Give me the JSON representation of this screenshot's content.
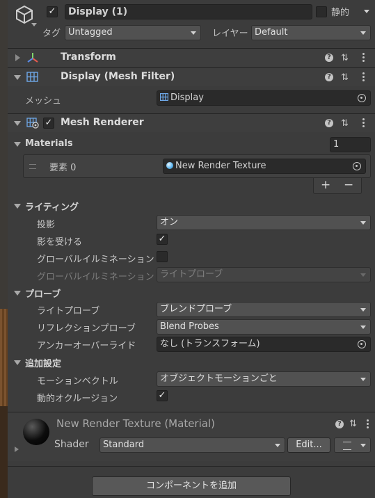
{
  "header": {
    "name": "Display (1)",
    "static_label": "静的",
    "tag_label": "タグ",
    "tag_value": "Untagged",
    "layer_label": "レイヤー",
    "layer_value": "Default"
  },
  "transform": {
    "title": "Transform"
  },
  "mesh_filter": {
    "title": "Display (Mesh Filter)",
    "mesh_label": "メッシュ",
    "mesh_value": "Display"
  },
  "mesh_renderer": {
    "title": "Mesh Renderer",
    "materials_label": "Materials",
    "materials_count": "1",
    "element_label": "要素 0",
    "element_value": "New Render Texture",
    "add": "+",
    "remove": "−",
    "lighting": {
      "title": "ライティング",
      "cast_shadows_label": "投影",
      "cast_shadows_value": "オン",
      "receive_shadows_label": "影を受ける",
      "contribute_gi_label": "グローバルイルミネーションに影響",
      "receive_gi_label": "グローバルイルミネーションを受ける",
      "receive_gi_value": "ライトプローブ"
    },
    "probes": {
      "title": "プローブ",
      "light_probes_label": "ライトプローブ",
      "light_probes_value": "ブレンドプローブ",
      "reflection_label": "リフレクションプローブ",
      "reflection_value": "Blend Probes",
      "anchor_label": "アンカーオーバーライド",
      "anchor_value": "なし (トランスフォーム)"
    },
    "additional": {
      "title": "追加設定",
      "motion_label": "モーションベクトル",
      "motion_value": "オブジェクトモーションごと",
      "occlusion_label": "動的オクルージョン"
    }
  },
  "material": {
    "title": "New Render Texture (Material)",
    "shader_label": "Shader",
    "shader_value": "Standard",
    "edit_label": "Edit..."
  },
  "add_component_label": "コンポーネントを追加",
  "colors": {
    "panel": "#3c3c3c",
    "field": "#2a2a2a",
    "header": "#3e3e3e",
    "accent_icon": "#6ea8e8"
  }
}
